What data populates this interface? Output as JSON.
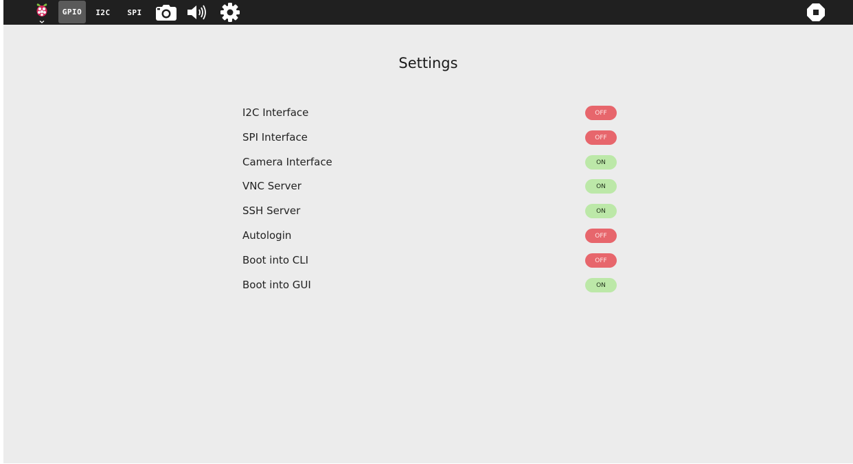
{
  "topbar": {
    "tabs": [
      {
        "label": "GPIO",
        "active": true
      },
      {
        "label": "I2C",
        "active": false
      },
      {
        "label": "SPI",
        "active": false
      }
    ],
    "icons": [
      "raspberry-logo-icon",
      "chevron-down-icon",
      "camera-icon",
      "speaker-icon",
      "gear-icon",
      "stop-icon"
    ]
  },
  "main": {
    "title": "Settings",
    "settings": [
      {
        "label": "I2C Interface",
        "state": "OFF"
      },
      {
        "label": "SPI Interface",
        "state": "OFF"
      },
      {
        "label": "Camera Interface",
        "state": "ON"
      },
      {
        "label": "VNC Server",
        "state": "ON"
      },
      {
        "label": "SSH Server",
        "state": "ON"
      },
      {
        "label": "Autologin",
        "state": "OFF"
      },
      {
        "label": "Boot into CLI",
        "state": "OFF"
      },
      {
        "label": "Boot into GUI",
        "state": "ON"
      }
    ]
  },
  "colors": {
    "topbar": "#202020",
    "background": "#ececec",
    "toggle_off": "#e7666c",
    "toggle_on": "#bce8a8",
    "active_tab": "#5a5a5a"
  }
}
